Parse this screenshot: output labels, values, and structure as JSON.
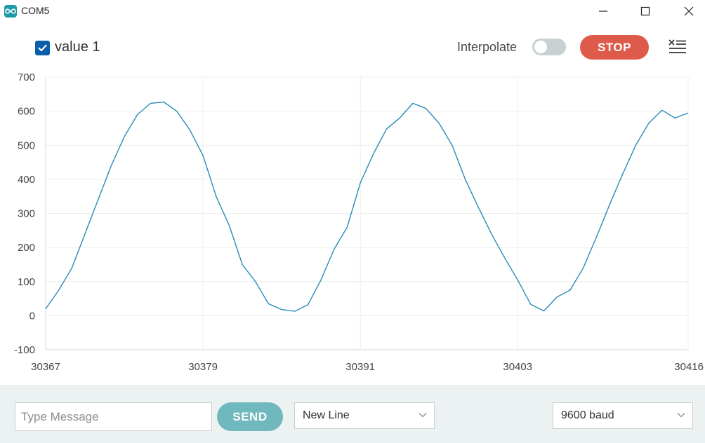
{
  "window": {
    "title": "COM5",
    "app_icon": "arduino-infinity-icon"
  },
  "toolbar": {
    "series_label": "value 1",
    "series_checked": true,
    "interpolate_label": "Interpolate",
    "interpolate_on": false,
    "stop_label": "STOP",
    "clear_icon": "clear-list-icon"
  },
  "footer": {
    "message_placeholder": "Type Message",
    "message_value": "",
    "send_label": "SEND",
    "line_ending": "New Line",
    "baud": "9600 baud"
  },
  "colors": {
    "line": "#2a8ab8",
    "stop_button": "#de5a4a",
    "send_button": "#6fb8bd",
    "checkbox": "#0b5ea8",
    "footer_bg": "#ecf1f1"
  },
  "chart_data": {
    "type": "line",
    "grid": true,
    "ylim": [
      -100,
      700
    ],
    "y_ticks": [
      "700",
      "600",
      "500",
      "400",
      "300",
      "200",
      "100",
      "0",
      "-100"
    ],
    "xlim": [
      30367,
      30416
    ],
    "x_ticks": [
      "30367",
      "30379",
      "30391",
      "30403",
      "30416"
    ],
    "series": [
      {
        "x": [
          30367,
          30368,
          30369,
          30370,
          30371,
          30372,
          30373,
          30374,
          30375,
          30376,
          30377,
          30378,
          30379,
          30380,
          30381,
          30382,
          30383,
          30384,
          30385,
          30386,
          30387,
          30388,
          30389,
          30390,
          30391,
          30392,
          30393,
          30394,
          30395,
          30396,
          30397,
          30398,
          30399,
          30400,
          30401,
          30402,
          30403,
          30404,
          30405,
          30406,
          30407,
          30408,
          30409,
          30410,
          30411,
          30412,
          30413,
          30414,
          30415,
          30416
        ],
        "values": [
          20,
          75,
          140,
          240,
          340,
          440,
          525,
          590,
          623,
          627,
          600,
          545,
          470,
          350,
          265,
          150,
          100,
          35,
          18,
          13,
          32,
          105,
          195,
          260,
          390,
          475,
          548,
          580,
          623,
          608,
          565,
          500,
          400,
          318,
          240,
          170,
          105,
          33,
          14,
          55,
          75,
          140,
          230,
          325,
          415,
          500,
          565,
          603,
          580,
          595
        ]
      }
    ]
  }
}
